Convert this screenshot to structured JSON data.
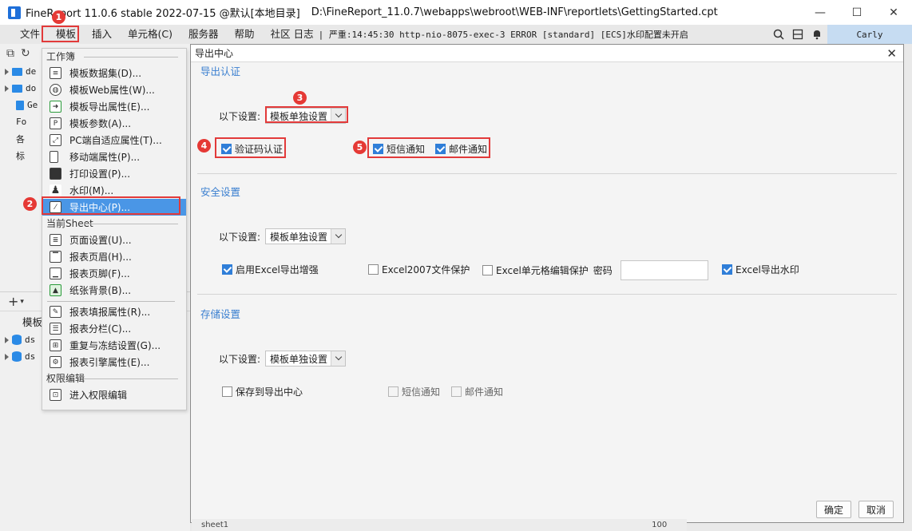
{
  "titlebar": {
    "title": "FineReport 11.0.6 stable 2022-07-15 @默认[本地目录]",
    "path": "D:\\FineReport_11.0.7\\webapps\\webroot\\WEB-INF\\reportlets\\GettingStarted.cpt",
    "minimize": "—",
    "maximize": "☐",
    "close": "✕"
  },
  "menubar": {
    "items": [
      "文件",
      "模板",
      "插入",
      "单元格(C)",
      "服务器",
      "帮助",
      "社区",
      "日志"
    ],
    "log": "| 严重:14:45:30 http-nio-8075-exec-3 ERROR [standard] [ECS]水印配置未开启",
    "user": "Carly"
  },
  "leftpanel": {
    "nodes": [
      "de",
      "do",
      "Ge",
      "Fo",
      "各",
      "标"
    ],
    "ds_nodes": [
      "ds",
      "ds"
    ],
    "tab_label": "模板"
  },
  "menu": {
    "section_workbook": "工作簿",
    "workbook_items": [
      {
        "label": "模板数据集(D)...",
        "icon": "database-icon"
      },
      {
        "label": "模板Web属性(W)...",
        "icon": "globe-icon"
      },
      {
        "label": "模板导出属性(E)...",
        "icon": "export-icon"
      },
      {
        "label": "模板参数(A)...",
        "icon": "parameter-icon"
      },
      {
        "label": "PC端自适应属性(T)...",
        "icon": "adaptive-icon"
      },
      {
        "label": "移动端属性(P)...",
        "icon": "mobile-icon"
      },
      {
        "label": "打印设置(P)...",
        "icon": "printer-icon"
      },
      {
        "label": "水印(M)...",
        "icon": "stamp-icon"
      },
      {
        "label": "导出中心(P)...",
        "icon": "export-center-icon"
      }
    ],
    "section_sheet": "当前Sheet",
    "sheet_items": [
      {
        "label": "页面设置(U)...",
        "icon": "page-setup-icon"
      },
      {
        "label": "报表页眉(H)...",
        "icon": "header-icon"
      },
      {
        "label": "报表页脚(F)...",
        "icon": "footer-icon"
      },
      {
        "label": "纸张背景(B)...",
        "icon": "background-icon"
      }
    ],
    "sheet_items_2": [
      {
        "label": "报表填报属性(R)...",
        "icon": "fill-report-icon"
      },
      {
        "label": "报表分栏(C)...",
        "icon": "columns-icon"
      },
      {
        "label": "重复与冻结设置(G)...",
        "icon": "freeze-icon"
      },
      {
        "label": "报表引擎属性(E)...",
        "icon": "engine-icon"
      }
    ],
    "section_permission": "权限编辑",
    "permission_items": [
      {
        "label": "进入权限编辑",
        "icon": "permission-icon"
      }
    ]
  },
  "dialog": {
    "title": "导出中心",
    "export_auth": {
      "title": "导出认证",
      "setting_label": "以下设置:",
      "setting_value": "模板单独设置",
      "captcha": {
        "label": "验证码认证",
        "checked": true
      },
      "sms": {
        "label": "短信通知",
        "checked": true
      },
      "email": {
        "label": "邮件通知",
        "checked": true
      }
    },
    "security": {
      "title": "安全设置",
      "setting_label": "以下设置:",
      "setting_value": "模板单独设置",
      "excel_enhance": {
        "label": "启用Excel导出增强",
        "checked": true
      },
      "excel2007": {
        "label": "Excel2007文件保护",
        "checked": false
      },
      "cell_protect": {
        "label": "Excel单元格编辑保护",
        "checked": false
      },
      "password_label": "密码",
      "watermark": {
        "label": "Excel导出水印",
        "checked": true
      }
    },
    "storage": {
      "title": "存储设置",
      "setting_label": "以下设置:",
      "setting_value": "模板单独设置",
      "save_center": {
        "label": "保存到导出中心",
        "checked": false
      },
      "sms": {
        "label": "短信通知",
        "checked": false
      },
      "email": {
        "label": "邮件通知",
        "checked": false
      }
    },
    "ok": "确定",
    "cancel": "取消"
  },
  "badges": [
    "1",
    "2",
    "3",
    "4",
    "5"
  ],
  "sheetstrip": {
    "sheet": "sheet1",
    "zoom": "100"
  },
  "colors": {
    "accent": "#4a96e6",
    "annotation": "#e23a3a",
    "section_title": "#3a7fd0"
  }
}
